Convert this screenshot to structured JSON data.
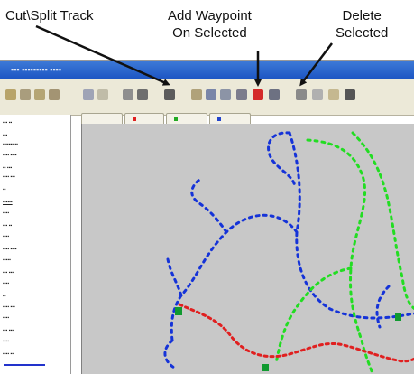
{
  "callouts": {
    "cut_split": "Cut\\Split Track",
    "add_waypoint_line1": "Add Waypoint",
    "add_waypoint_line2": "On Selected",
    "delete_line1": "Delete",
    "delete_line2": "Selected"
  },
  "colors": {
    "titlebar": "#1d56c4",
    "map_background": "#c8c8c8",
    "track_blue": "#1533d8",
    "track_green": "#22dd22",
    "track_red": "#e02020",
    "waypoint_green": "#109a30"
  },
  "icons": {
    "callout_arrow": "arrow-icon",
    "toolbar": [
      "tool-icon"
    ]
  }
}
